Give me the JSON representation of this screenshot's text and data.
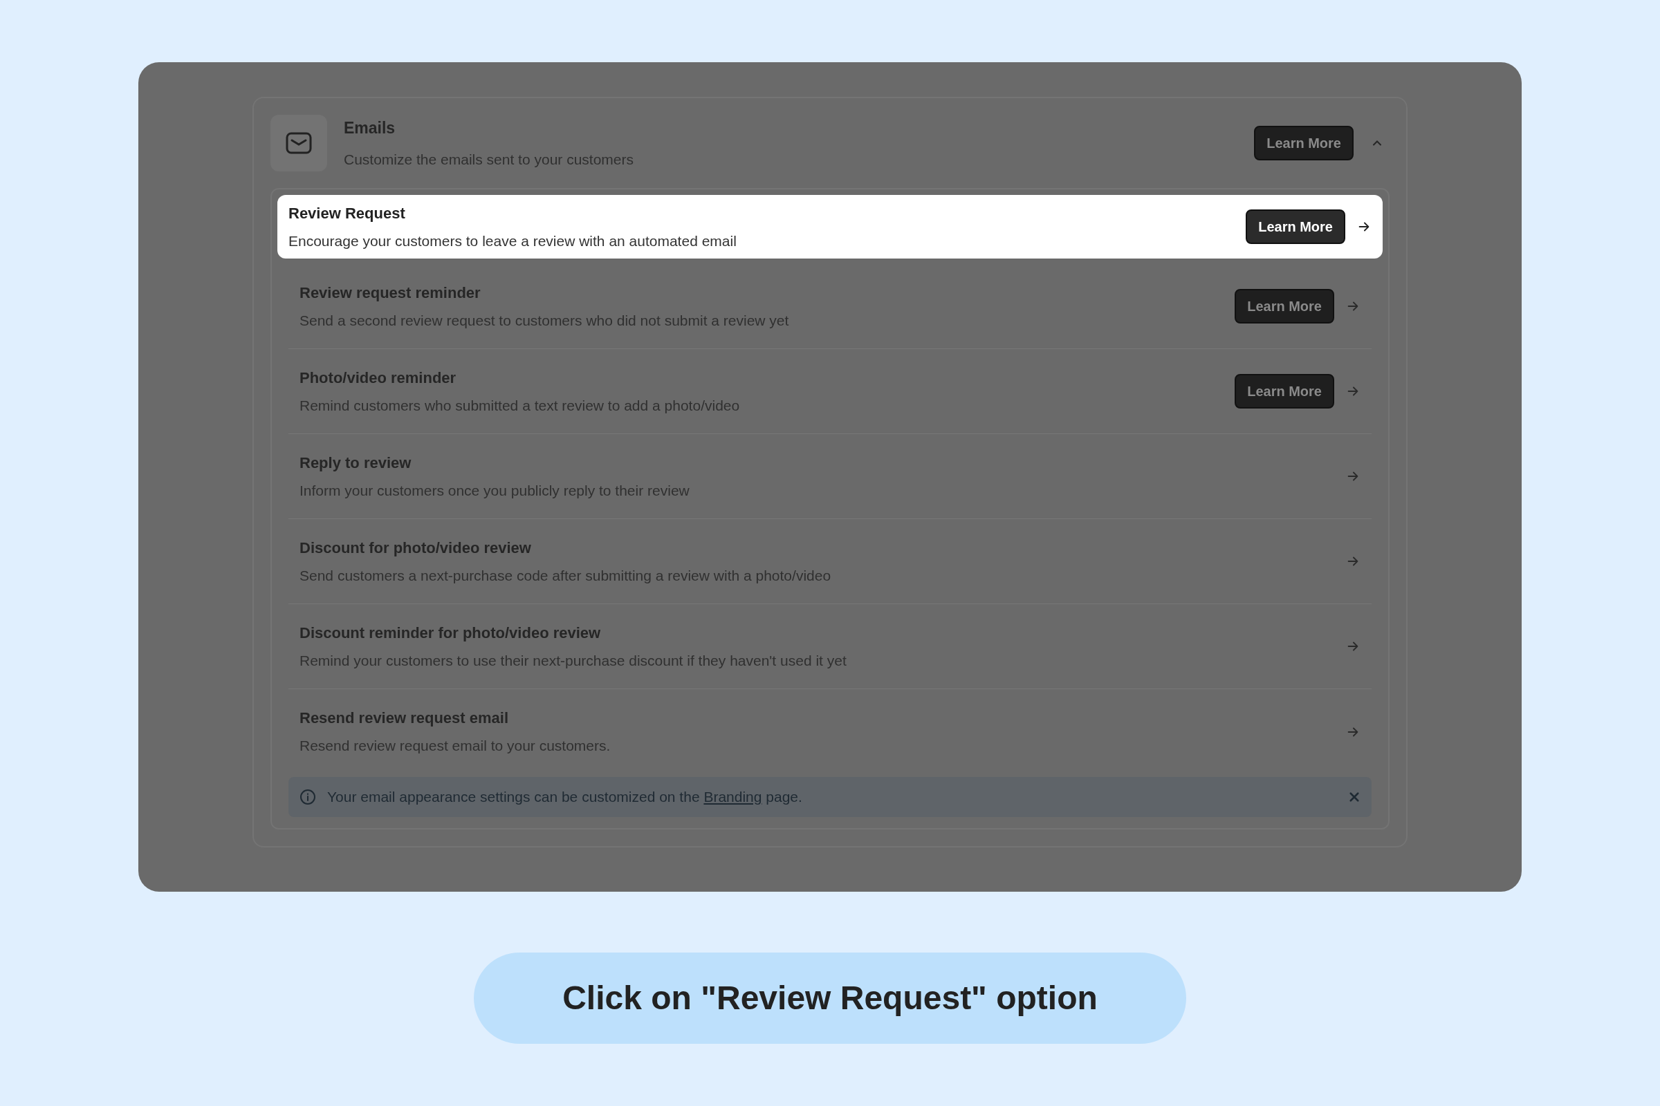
{
  "section": {
    "title": "Emails",
    "description": "Customize the emails sent to your customers",
    "button": "Learn More",
    "expanded": true
  },
  "rows": [
    {
      "title": "Review Request",
      "description": "Encourage your customers to leave a review with an automated email",
      "button": "Learn More",
      "highlighted": true
    },
    {
      "title": "Review request reminder",
      "description": "Send a second review request to customers who did not submit a review yet",
      "button": "Learn More",
      "highlighted": false
    },
    {
      "title": "Photo/video reminder",
      "description": "Remind customers who submitted a text review to add a photo/video",
      "button": "Learn More",
      "highlighted": false
    },
    {
      "title": "Reply to review",
      "description": "Inform your customers once you publicly reply to their review",
      "highlighted": false
    },
    {
      "title": "Discount for photo/video review",
      "description": "Send customers a next-purchase code after submitting a review with a photo/video",
      "highlighted": false
    },
    {
      "title": "Discount reminder for photo/video review",
      "description": "Remind your customers to use their next-purchase discount if they haven't used it yet",
      "highlighted": false
    },
    {
      "title": "Resend review request email",
      "description": "Resend review request email to your customers.",
      "highlighted": false
    }
  ],
  "notice": {
    "before": "Your email appearance settings can be customized on the ",
    "link": "Branding",
    "after": " page."
  },
  "caption": "Click on \"Review Request\" option"
}
